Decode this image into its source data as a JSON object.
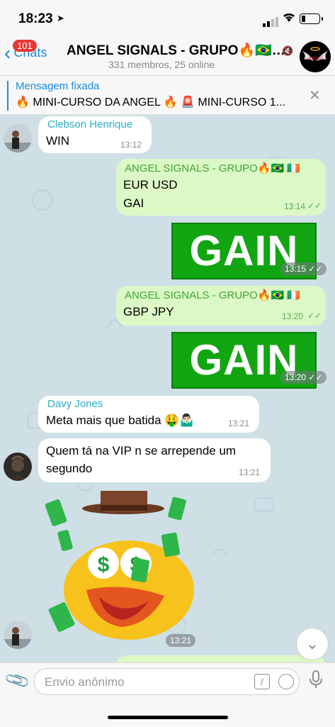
{
  "status": {
    "time": "18:23"
  },
  "header": {
    "back_label": "Chats",
    "badge": "101",
    "title": "ANGEL SIGNALS - GRUPO🔥🇧🇷…",
    "subtitle": "331 membros, 25 online"
  },
  "pinned": {
    "label": "Mensagem fixada",
    "text": "🔥 MINI-CURSO DA ANGEL 🔥 🚨 MINI-CURSO 1..."
  },
  "messages": [
    {
      "sender": "Clebson Henrique",
      "text": "WIN",
      "time": "13:12"
    },
    {
      "sender": "ANGEL SIGNALS - GRUPO🔥🇧🇷 🇮🇪",
      "line1": "EUR USD",
      "line2": "GAI",
      "time": "13:14"
    },
    {
      "image_text": "GAIN",
      "time": "13:15"
    },
    {
      "sender": "ANGEL SIGNALS - GRUPO🔥🇧🇷 🇮🇪",
      "text": "GBP JPY",
      "time": "13:20"
    },
    {
      "image_text": "GAIN",
      "time": "13:20"
    },
    {
      "sender": "Davy Jones",
      "text": "Meta mais que batida 🤑🤷🏻‍♂️",
      "time": "13:21"
    },
    {
      "line1": "Quem tá na VIP n se arrepende um",
      "line2": "segundo",
      "time": "13:21"
    },
    {
      "sticker": "duck-money-sticker",
      "time": "13:21"
    }
  ],
  "input": {
    "placeholder": "Envio anônimo",
    "value": ""
  },
  "colors": {
    "accent": "#1b8bdd",
    "out_bubble": "#dcf8c6",
    "sender_green": "#3fa535",
    "sender_cyan": "#29b0c4"
  }
}
